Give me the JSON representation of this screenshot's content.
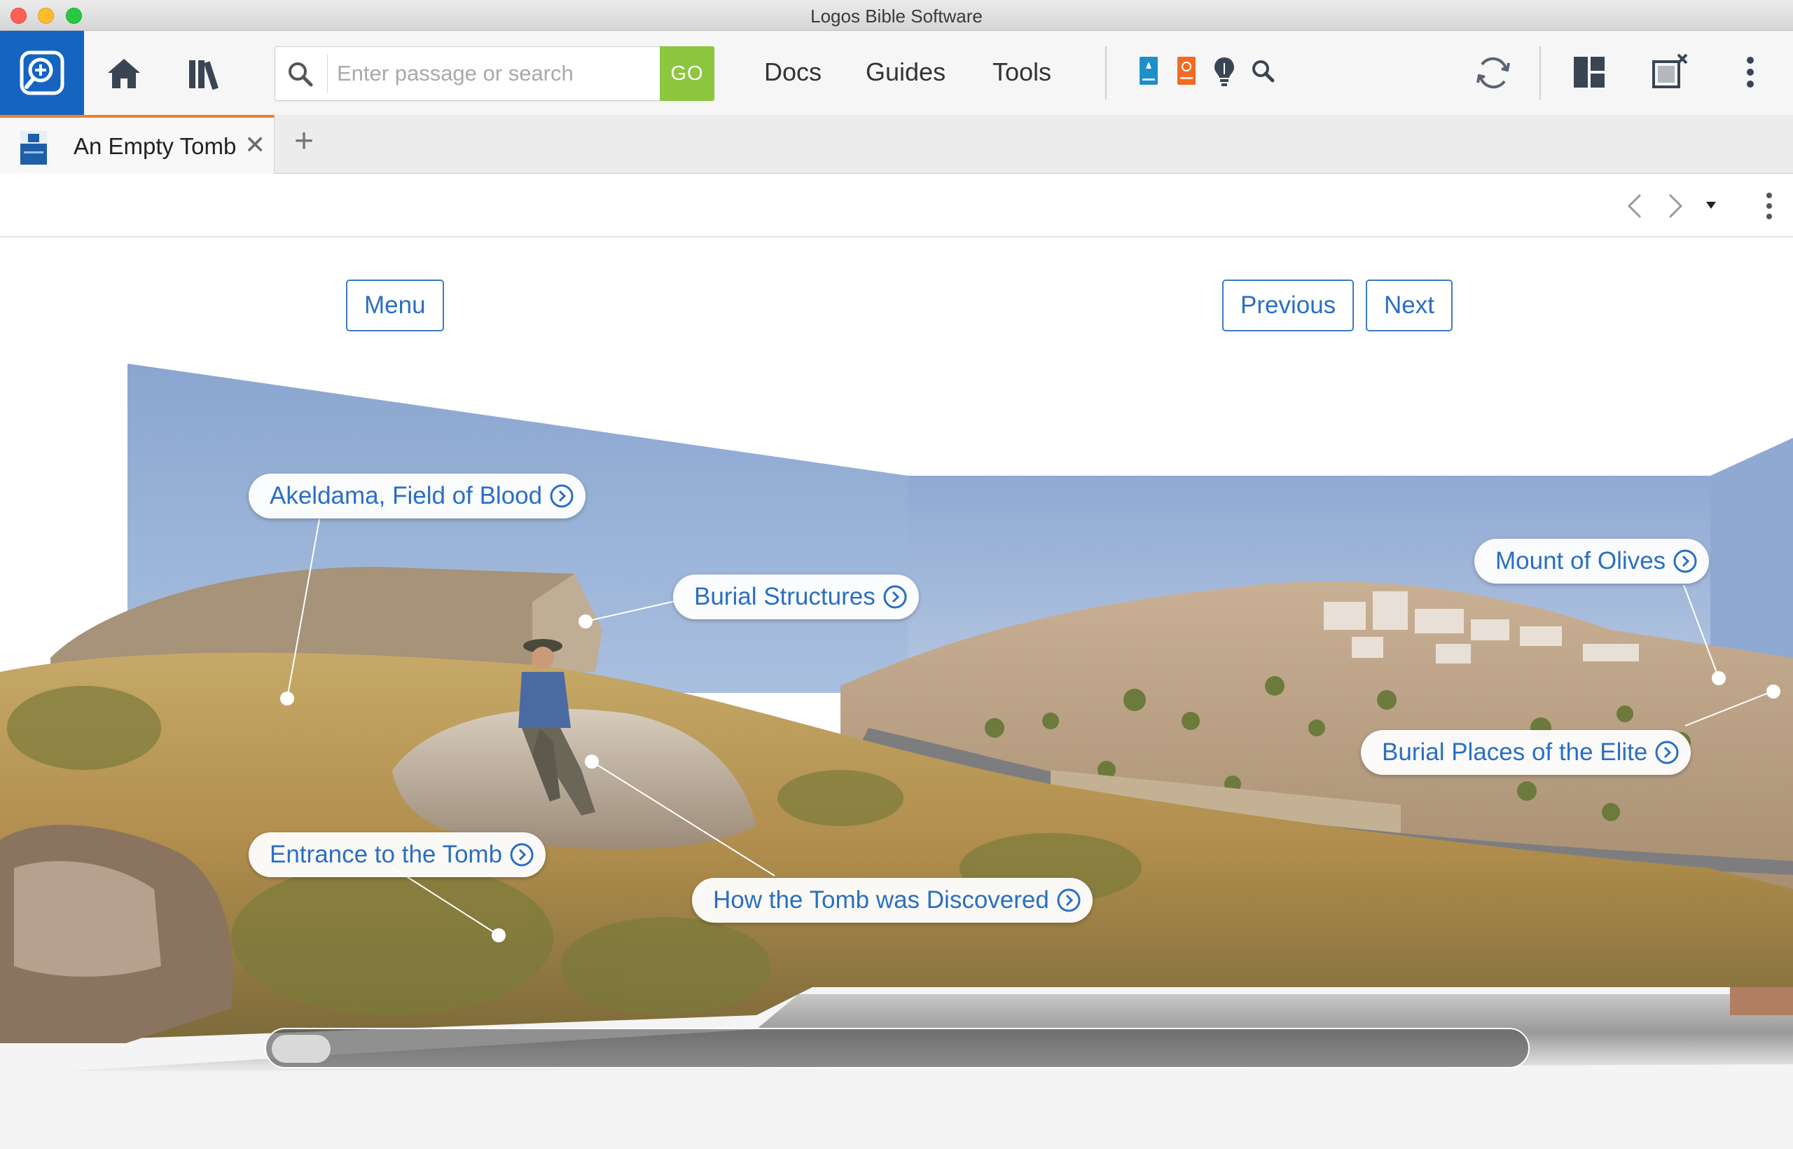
{
  "window": {
    "title": "Logos Bible Software"
  },
  "toolbar": {
    "search_placeholder": "Enter passage or search",
    "go_label": "GO",
    "menus": [
      "Docs",
      "Guides",
      "Tools"
    ],
    "icons": [
      "home-icon",
      "library-icon",
      "search-icon",
      "sync-icon",
      "layout-icon",
      "panel-popout-icon",
      "more-icon"
    ]
  },
  "tabs": [
    {
      "title": "An Empty Tomb",
      "close": "✕"
    }
  ],
  "tab_add": "+",
  "content": {
    "menu_label": "Menu",
    "previous_label": "Previous",
    "next_label": "Next",
    "hotspots": [
      "Akeldama, Field of Blood",
      "Burial Structures",
      "Mount of Olives",
      "Burial Places of the Elite",
      "Entrance to the Tomb",
      "How the Tomb was Discovered"
    ]
  },
  "colors": {
    "brand_blue": "#1565c0",
    "go_green": "#8dc63f",
    "tab_accent": "#ef7f2c",
    "link_blue": "#2a6fc1"
  }
}
